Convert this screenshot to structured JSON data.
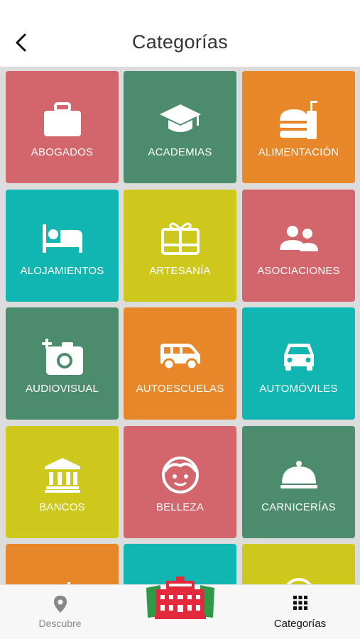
{
  "header": {
    "title": "Categorías"
  },
  "colors": {
    "red": "#d3666c",
    "green": "#4c8c6c",
    "orange": "#e8862a",
    "teal": "#11b6b3",
    "yellow": "#cdc81b"
  },
  "categories": [
    {
      "label": "ABOGADOS",
      "icon": "briefcase-icon",
      "color": "#d3666c"
    },
    {
      "label": "ACADEMIAS",
      "icon": "graduation-cap-icon",
      "color": "#4c8c6c"
    },
    {
      "label": "ALIMENTACIÓN",
      "icon": "fast-food-icon",
      "color": "#e8862a"
    },
    {
      "label": "ALOJAMIENTOS",
      "icon": "bed-icon",
      "color": "#11b6b3"
    },
    {
      "label": "ARTESANÍA",
      "icon": "gift-card-icon",
      "color": "#cdc81b"
    },
    {
      "label": "ASOCIACIONES",
      "icon": "people-icon",
      "color": "#d3666c"
    },
    {
      "label": "AUDIOVISUAL",
      "icon": "add-camera-icon",
      "color": "#4c8c6c"
    },
    {
      "label": "AUTOESCUELAS",
      "icon": "van-icon",
      "color": "#e8862a"
    },
    {
      "label": "AUTOMÓVILES",
      "icon": "car-icon",
      "color": "#11b6b3"
    },
    {
      "label": "BANCOS",
      "icon": "bank-icon",
      "color": "#cdc81b"
    },
    {
      "label": "BELLEZA",
      "icon": "face-icon",
      "color": "#d3666c"
    },
    {
      "label": "CARNICERÍAS",
      "icon": "food-cloche-icon",
      "color": "#4c8c6c"
    },
    {
      "label": "",
      "icon": "partial-icon",
      "color": "#e8862a"
    },
    {
      "label": "",
      "icon": "partial-icon",
      "color": "#11b6b3"
    },
    {
      "label": "",
      "icon": "partial-icon",
      "color": "#cdc81b"
    }
  ],
  "tabbar": {
    "left_label": "Descubre",
    "left_icon": "location-pin-icon",
    "center_icon": "town-hall-logo-icon",
    "right_label": "Categorías",
    "right_icon": "grid-icon"
  }
}
